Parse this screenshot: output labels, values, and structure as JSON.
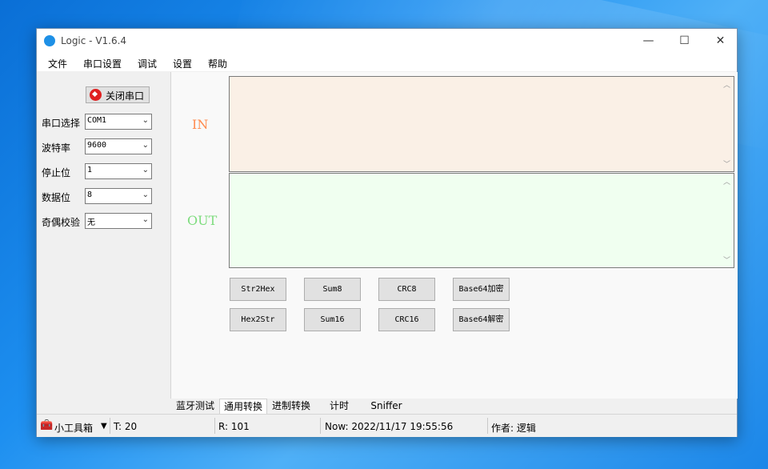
{
  "window": {
    "title": "Logic - V1.6.4",
    "minimize": "—",
    "maximize": "☐",
    "close": "✕"
  },
  "menu": [
    "文件",
    "串口设置",
    "调试",
    "设置",
    "帮助"
  ],
  "left": {
    "close_port_label": "关闭串口",
    "fields": [
      {
        "label": "串口选择",
        "value": "COM1"
      },
      {
        "label": "波特率",
        "value": "9600"
      },
      {
        "label": "停止位",
        "value": "1"
      },
      {
        "label": "数据位",
        "value": "8"
      },
      {
        "label": "奇偶校验",
        "value": "无"
      }
    ]
  },
  "io": {
    "in_label": "IN",
    "out_label": "OUT",
    "in_color": "#ff8c50",
    "out_color": "#7ddc7d",
    "in_bg": "#faf0e6",
    "out_bg": "#f0fff0"
  },
  "buttons": {
    "row1": [
      "Str2Hex",
      "Sum8",
      "CRC8",
      "Base64加密"
    ],
    "row2": [
      "Hex2Str",
      "Sum16",
      "CRC16",
      "Base64解密"
    ]
  },
  "tabs": [
    "蓝牙测试",
    "通用转换",
    "进制转换",
    "计时",
    "Sniffer"
  ],
  "active_tab": "通用转换",
  "status": {
    "toolbox": "小工具箱",
    "t": "T:  20",
    "r": "R:  101",
    "now": "Now:  2022/11/17 19:55:56",
    "author": "作者: 逻辑"
  }
}
